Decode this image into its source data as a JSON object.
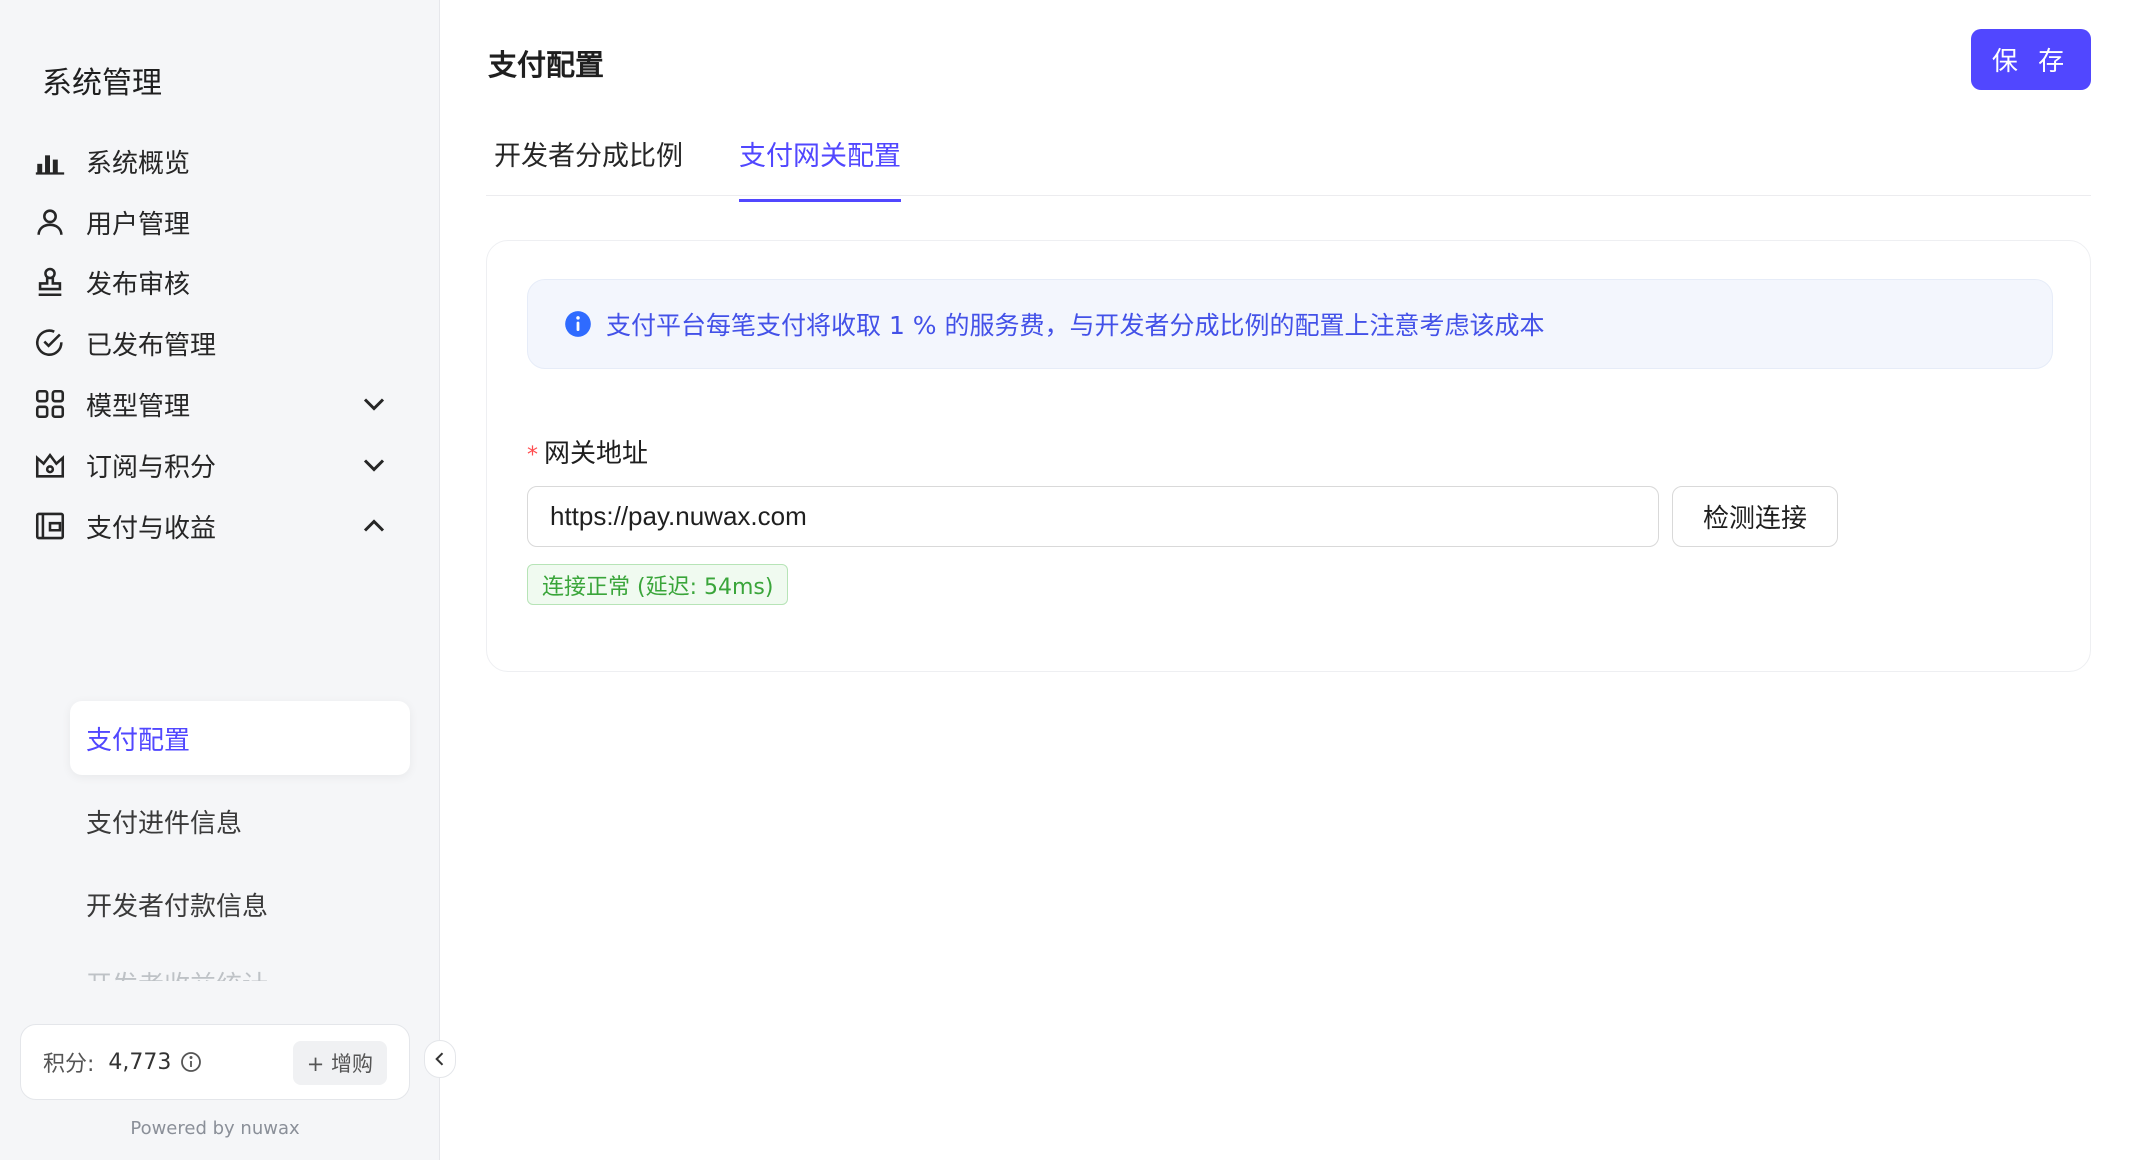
{
  "sidebar": {
    "title": "系统管理",
    "items": [
      {
        "label": "系统概览",
        "icon": "bar-chart-icon"
      },
      {
        "label": "用户管理",
        "icon": "user-icon"
      },
      {
        "label": "发布审核",
        "icon": "stamp-icon"
      },
      {
        "label": "已发布管理",
        "icon": "check-circle-icon"
      },
      {
        "label": "模型管理",
        "icon": "grid-icon",
        "expanded": false
      },
      {
        "label": "订阅与积分",
        "icon": "crown-icon",
        "expanded": false
      },
      {
        "label": "支付与收益",
        "icon": "wallet-icon",
        "expanded": true
      }
    ],
    "sub_items": [
      {
        "label": "支付配置",
        "active": true
      },
      {
        "label": "支付进件信息"
      },
      {
        "label": "开发者付款信息"
      },
      {
        "label": "开发者收益统计"
      }
    ],
    "points_label": "积分:",
    "points_value": "4,773",
    "buy_label": "+ 增购",
    "powered": "Powered by nuwax"
  },
  "header": {
    "title": "支付配置",
    "save_label": "保 存"
  },
  "tabs": [
    {
      "label": "开发者分成比例",
      "active": false
    },
    {
      "label": "支付网关配置",
      "active": true
    }
  ],
  "gateway": {
    "notice": "支付平台每笔支付将收取 1 % 的服务费，与开发者分成比例的配置上注意考虑该成本",
    "field_label": "网关地址",
    "url_value": "https://pay.nuwax.com",
    "check_label": "检测连接",
    "status": "连接正常 (延迟: 54ms)"
  },
  "colors": {
    "accent": "#5147ff",
    "success": "#3aa53a",
    "info": "#4351e8"
  }
}
